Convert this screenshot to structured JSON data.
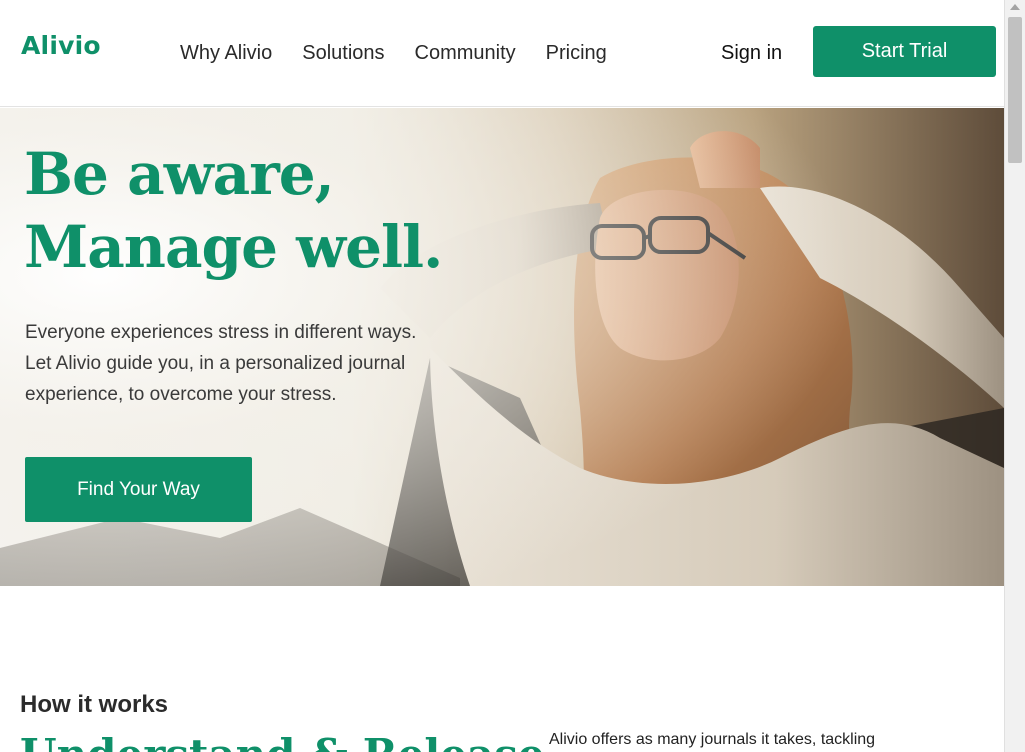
{
  "brand": {
    "logo": "Alivio",
    "accent_color": "#0f9069"
  },
  "nav": {
    "items": [
      {
        "label": "Why Alivio"
      },
      {
        "label": "Solutions"
      },
      {
        "label": "Community"
      },
      {
        "label": "Pricing"
      }
    ],
    "signin_label": "Sign in",
    "start_trial_label": "Start Trial"
  },
  "hero": {
    "title_line1": "Be aware,",
    "title_line2": "Manage well.",
    "text": "Everyone experiences stress in different ways. Let Alivio guide you, in a personalized journal experience, to overcome your stress.",
    "cta_label": "Find Your Way",
    "image": "woman-relaxing-photo"
  },
  "how_it_works": {
    "label": "How it works",
    "heading": "Understand & Release",
    "description": "Alivio offers as many journals it takes, tackling"
  }
}
